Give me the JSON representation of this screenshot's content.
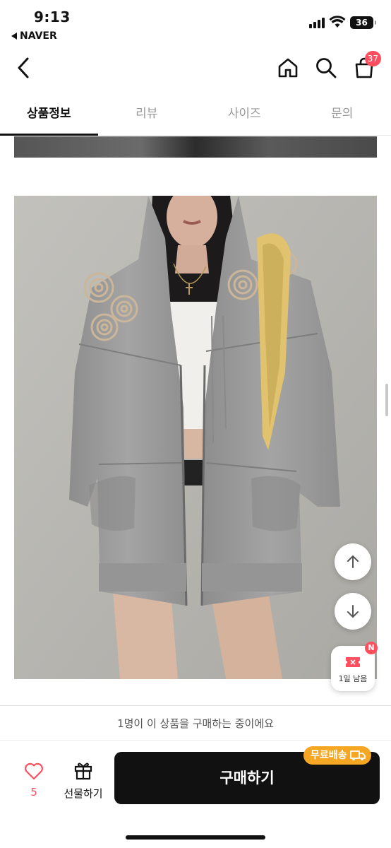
{
  "status_bar": {
    "time": "9:13",
    "back_app": "NAVER",
    "battery": "36"
  },
  "header": {
    "cart_count": "37",
    "icons": [
      "back-arrow-icon",
      "home-icon",
      "search-icon",
      "shopping-bag-icon"
    ]
  },
  "tabs": [
    {
      "label": "상품정보",
      "active": true
    },
    {
      "label": "리뷰",
      "active": false
    },
    {
      "label": "사이즈",
      "active": false
    },
    {
      "label": "문의",
      "active": false
    }
  ],
  "floating": {
    "coupon_badge": "N",
    "coupon_label": "1일 남음"
  },
  "footer": {
    "buying_notice": "1명이 이 상품을 구매하는 중이에요",
    "like_count": "5",
    "gift_label": "선물하기",
    "buy_label": "구매하기",
    "free_shipping": "무료배송"
  },
  "colors": {
    "accent_red": "#ff4f5e",
    "shipping_orange": "#f5a623",
    "buy_button": "#111111"
  }
}
